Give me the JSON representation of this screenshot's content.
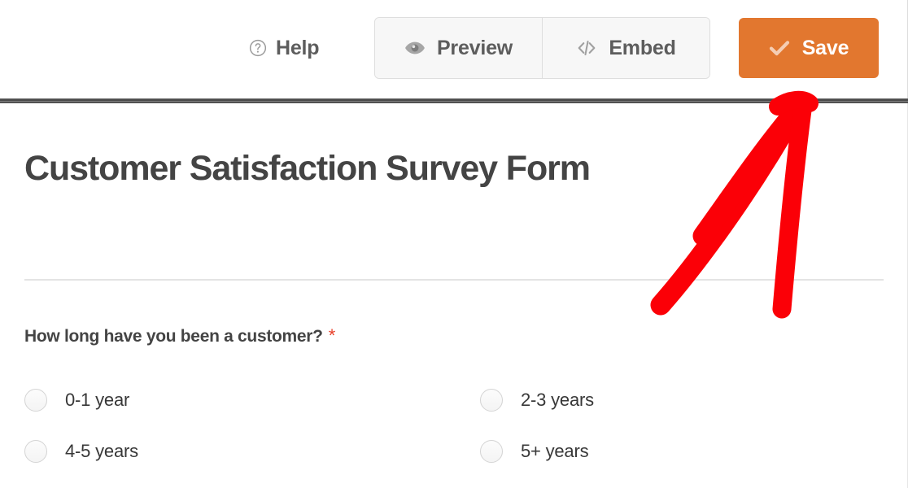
{
  "toolbar": {
    "help": {
      "label": "Help",
      "icon": "question-circle-icon"
    },
    "preview": {
      "label": "Preview",
      "icon": "eye-icon"
    },
    "embed": {
      "label": "Embed",
      "icon": "code-icon"
    },
    "save": {
      "label": "Save",
      "icon": "check-icon"
    }
  },
  "form": {
    "title": "Customer Satisfaction Survey Form",
    "field": {
      "label": "How long have you been a customer?",
      "required_mark": "*",
      "type": "radio",
      "selected": null,
      "options": [
        {
          "label": "0-1 year",
          "selected": false
        },
        {
          "label": "2-3 years",
          "selected": false
        },
        {
          "label": "4-5 years",
          "selected": false
        },
        {
          "label": "5+ years",
          "selected": false
        }
      ]
    }
  },
  "annotation": {
    "type": "hand-drawn-arrow",
    "color": "#fb0007",
    "points_to": "save-button"
  },
  "colors": {
    "accent_orange": "#e2772f",
    "save_check": "#f5cdb3",
    "required_red": "#e8402a",
    "annotation_red": "#fb0007",
    "text_dark": "#444444",
    "text_muted": "#5d5d5d",
    "separator_dark": "#4a4a4a"
  }
}
